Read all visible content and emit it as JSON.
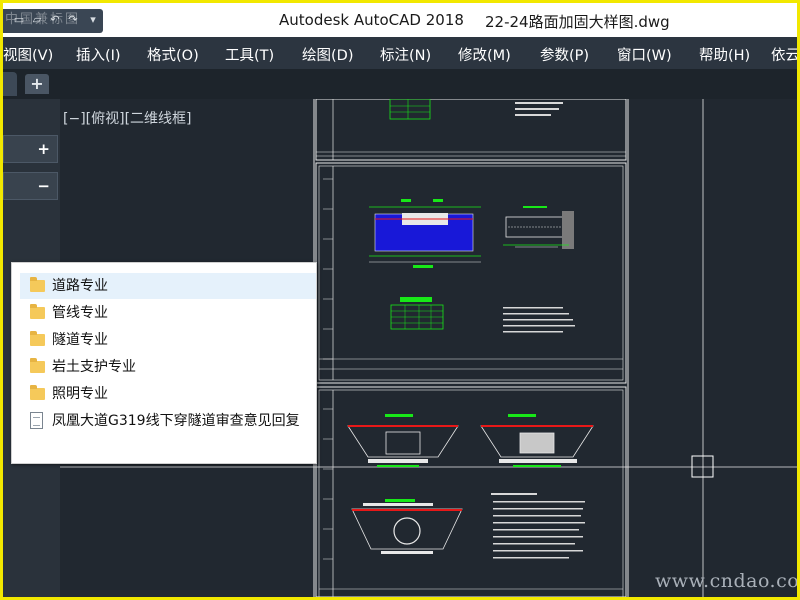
{
  "window": {
    "app_title": "Autodesk AutoCAD 2018",
    "file_title": "22-24路面加固大样图.dwg",
    "watermark_top": "中国兼标图"
  },
  "menu": {
    "items": [
      "视图(V)",
      "插入(I)",
      "格式(O)",
      "工具(T)",
      "绘图(D)",
      "标注(N)",
      "修改(M)",
      "参数(P)",
      "窗口(W)",
      "帮助(H)",
      "依云"
    ]
  },
  "tabs": {
    "add_label": "+"
  },
  "panel": {
    "expand_label": "+",
    "collapse_label": "−"
  },
  "viewport": {
    "label": "[−][俯视][二维线框]"
  },
  "file_list": {
    "items": [
      {
        "name": "道路专业",
        "type": "folder",
        "selected": true
      },
      {
        "name": "管线专业",
        "type": "folder",
        "selected": false
      },
      {
        "name": "隧道专业",
        "type": "folder",
        "selected": false
      },
      {
        "name": "岩土支护专业",
        "type": "folder",
        "selected": false
      },
      {
        "name": "照明专业",
        "type": "folder",
        "selected": false
      },
      {
        "name": "凤凰大道G319线下穿隧道审查意见回复",
        "type": "document",
        "selected": false
      }
    ]
  },
  "footer": {
    "watermark": "www.cndao.com"
  },
  "colors": {
    "frame": "#f2e800",
    "canvas": "#212830",
    "cad_white": "#e8e8e8",
    "cad_green": "#18e818",
    "cad_blue": "#1818d8",
    "cad_red": "#e81818"
  }
}
